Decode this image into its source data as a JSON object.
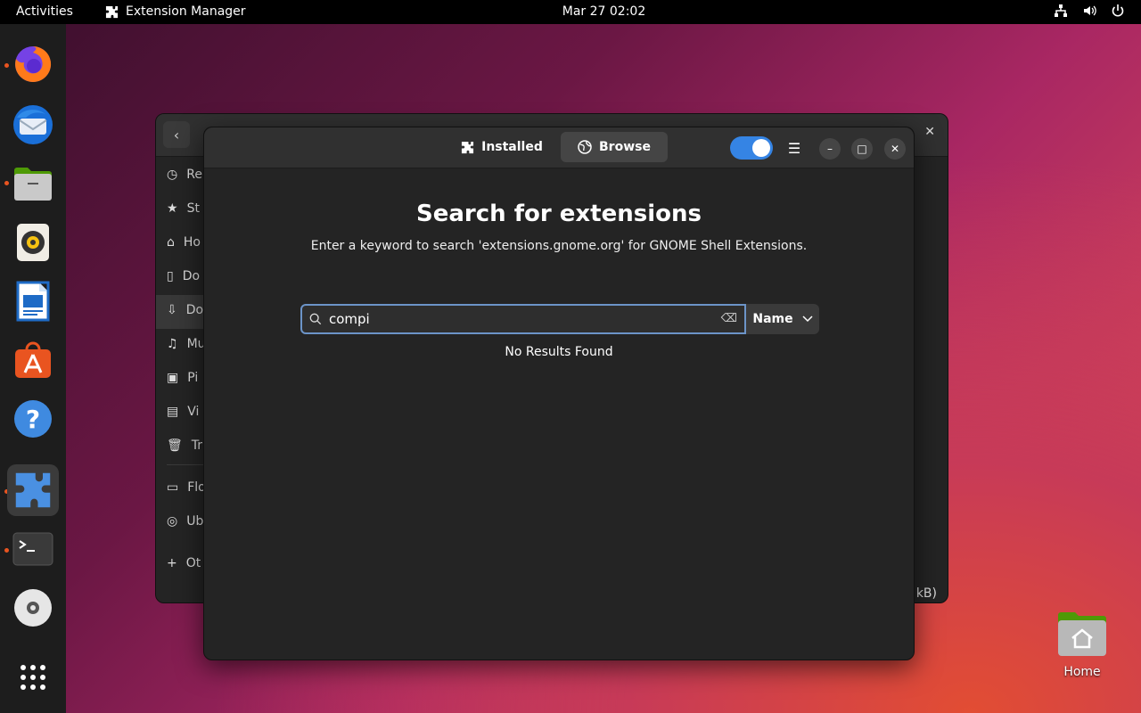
{
  "topbar": {
    "activities": "Activities",
    "app_name": "Extension Manager",
    "clock": "Mar 27  02:02"
  },
  "dock": {
    "items": [
      "firefox",
      "thunderbird",
      "files",
      "rhythmbox",
      "libreoffice-writer",
      "app-center",
      "help",
      "extension-manager",
      "terminal",
      "disc",
      "show-apps"
    ]
  },
  "files_window": {
    "sidebar": [
      "Re",
      "St",
      "Ho",
      "Do",
      "Do",
      "Mu",
      "Pi",
      "Vi",
      "Tr",
      "Flo",
      "Ub",
      "Ot"
    ],
    "footer": "kB)"
  },
  "ext_window": {
    "tabs": {
      "installed": "Installed",
      "browse": "Browse"
    },
    "title": "Search for extensions",
    "subtitle": "Enter a keyword to search 'extensions.gnome.org' for GNOME Shell Extensions.",
    "search_value": "compi",
    "sort_label": "Name",
    "no_results": "No Results Found",
    "toggle_on": true
  },
  "desktop": {
    "home_label": "Home"
  },
  "colors": {
    "accent": "#3584e4",
    "dot": "#e95420"
  }
}
